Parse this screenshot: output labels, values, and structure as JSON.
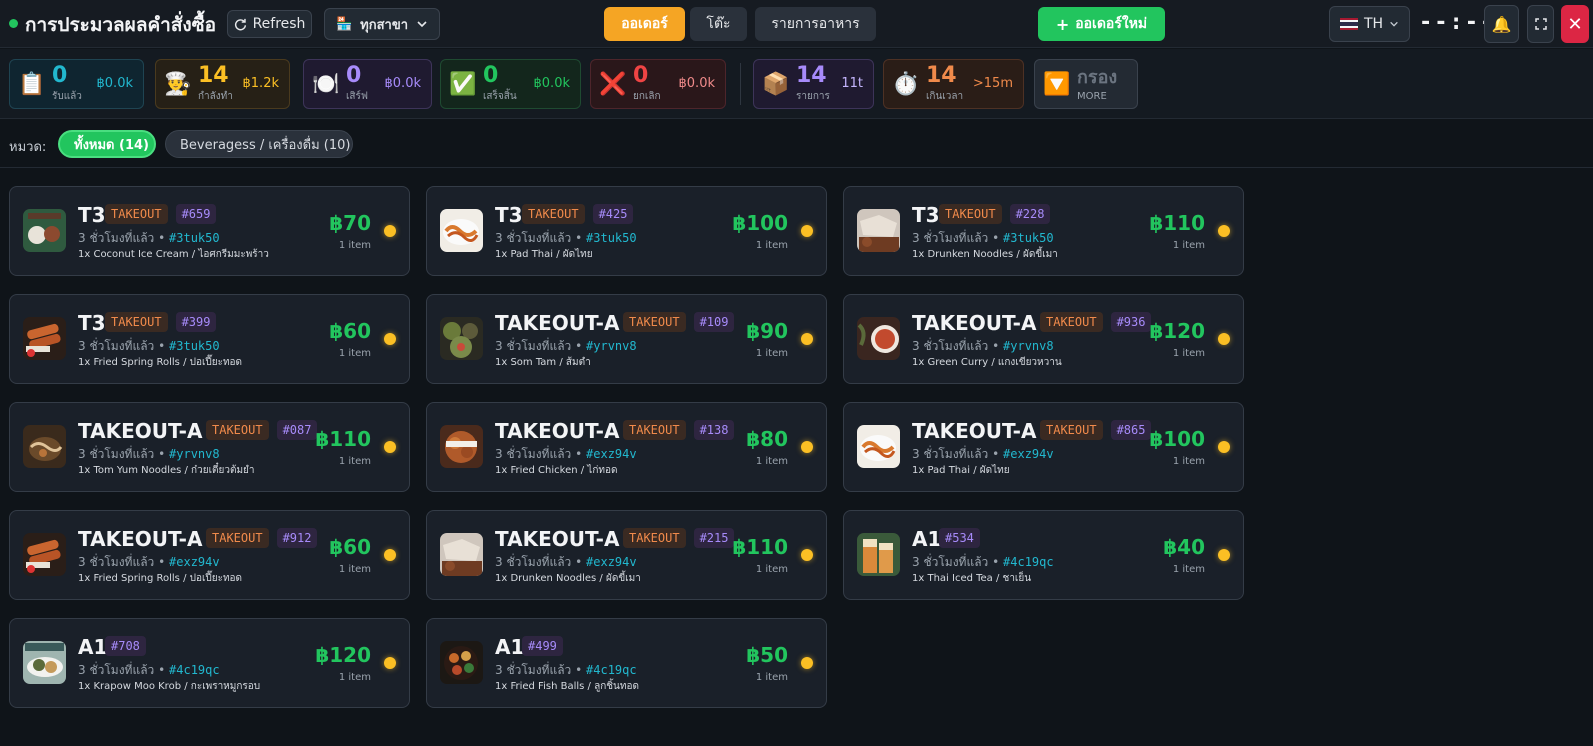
{
  "header": {
    "title": "การประมวลผลคำสั่งซื้อ",
    "refresh_label": "Refresh",
    "branch_label": "ทุกสาขา",
    "tabs": [
      "ออเดอร์",
      "โต๊ะ",
      "รายการอาหาร"
    ],
    "active_tab": "ออเดอร์",
    "new_order_label": "ออเดอร์ใหม่",
    "language": "TH",
    "clock": "--:--",
    "colors": {
      "accent": "#f5a524",
      "success": "#22c55e",
      "danger": "#dc2644"
    }
  },
  "stats": [
    {
      "icon": "📋",
      "count": "0",
      "label": "รับแล้ว",
      "value": "฿0.0k",
      "color": "#22b8cf"
    },
    {
      "icon": "👨‍🍳",
      "count": "14",
      "label": "กำลังทำ",
      "value": "฿1.2k",
      "color": "#fbbf24"
    },
    {
      "icon": "🍽️",
      "count": "0",
      "label": "เสิร์ฟ",
      "value": "฿0.0k",
      "color": "#a78bfa"
    },
    {
      "icon": "✅",
      "count": "0",
      "label": "เสร็จสิ้น",
      "value": "฿0.0k",
      "color": "#22c55e"
    },
    {
      "icon": "❌",
      "count": "0",
      "label": "ยกเลิก",
      "value": "฿0.0k",
      "color": "#ef4444"
    },
    {
      "icon": "📦",
      "count": "14",
      "label": "รายการ",
      "value": "11t",
      "color": "#a78bfa"
    },
    {
      "icon": "⏱️",
      "count": "14",
      "label": "เกินเวลา",
      "value": ">15m",
      "color": "#f08a4b"
    },
    {
      "icon": "🔽",
      "count": "กรอง",
      "label": "MORE",
      "value": "",
      "color": "#9aa3ad"
    }
  ],
  "categories": {
    "label": "หมวด:",
    "chips": [
      {
        "label": "ทั้งหมด  (14)",
        "active": true
      },
      {
        "label": "Beveragess / เครื่องดื่ม  (10)",
        "active": false
      }
    ]
  },
  "orders": [
    {
      "table": "T3",
      "type": "TAKEOUT",
      "number": "#659",
      "time": "3 ชั่วโมงที่แล้ว",
      "code": "#3tuk50",
      "items": "1x Coconut Ice Cream / ไอศกรีมมะพร้าว",
      "price": "฿70",
      "count": "1 item",
      "thumb": "dessert"
    },
    {
      "table": "T3",
      "type": "TAKEOUT",
      "number": "#425",
      "time": "3 ชั่วโมงที่แล้ว",
      "code": "#3tuk50",
      "items": "1x Pad Thai / ผัดไทย",
      "price": "฿100",
      "count": "1 item",
      "thumb": "noodle"
    },
    {
      "table": "T3",
      "type": "TAKEOUT",
      "number": "#228",
      "time": "3 ชั่วโมงที่แล้ว",
      "code": "#3tuk50",
      "items": "1x Drunken Noodles / ผัดขี้เมา",
      "price": "฿110",
      "count": "1 item",
      "thumb": "drunken"
    },
    {
      "table": "T3",
      "type": "TAKEOUT",
      "number": "#399",
      "time": "3 ชั่วโมงที่แล้ว",
      "code": "#3tuk50",
      "items": "1x Fried Spring Rolls / ปอเปี๊ยะทอด",
      "price": "฿60",
      "count": "1 item",
      "thumb": "roll"
    },
    {
      "table": "TAKEOUT-A",
      "type": "TAKEOUT",
      "number": "#109",
      "time": "3 ชั่วโมงที่แล้ว",
      "code": "#yrvnv8",
      "items": "1x Som Tam / ส้มตำ",
      "price": "฿90",
      "count": "1 item",
      "thumb": "salad"
    },
    {
      "table": "TAKEOUT-A",
      "type": "TAKEOUT",
      "number": "#936",
      "time": "3 ชั่วโมงที่แล้ว",
      "code": "#yrvnv8",
      "items": "1x Green Curry / แกงเขียวหวาน",
      "price": "฿120",
      "count": "1 item",
      "thumb": "curry"
    },
    {
      "table": "TAKEOUT-A",
      "type": "TAKEOUT",
      "number": "#087",
      "time": "3 ชั่วโมงที่แล้ว",
      "code": "#yrvnv8",
      "items": "1x Tom Yum Noodles / ก๋วยเตี๋ยวต้มยำ",
      "price": "฿110",
      "count": "1 item",
      "thumb": "tomyum"
    },
    {
      "table": "TAKEOUT-A",
      "type": "TAKEOUT",
      "number": "#138",
      "time": "3 ชั่วโมงที่แล้ว",
      "code": "#exz94v",
      "items": "1x Fried Chicken / ไก่ทอด",
      "price": "฿80",
      "count": "1 item",
      "thumb": "chicken"
    },
    {
      "table": "TAKEOUT-A",
      "type": "TAKEOUT",
      "number": "#865",
      "time": "3 ชั่วโมงที่แล้ว",
      "code": "#exz94v",
      "items": "1x Pad Thai / ผัดไทย",
      "price": "฿100",
      "count": "1 item",
      "thumb": "noodle"
    },
    {
      "table": "TAKEOUT-A",
      "type": "TAKEOUT",
      "number": "#912",
      "time": "3 ชั่วโมงที่แล้ว",
      "code": "#exz94v",
      "items": "1x Fried Spring Rolls / ปอเปี๊ยะทอด",
      "price": "฿60",
      "count": "1 item",
      "thumb": "roll"
    },
    {
      "table": "TAKEOUT-A",
      "type": "TAKEOUT",
      "number": "#215",
      "time": "3 ชั่วโมงที่แล้ว",
      "code": "#exz94v",
      "items": "1x Drunken Noodles / ผัดขี้เมา",
      "price": "฿110",
      "count": "1 item",
      "thumb": "drunken"
    },
    {
      "table": "A1",
      "type": "",
      "number": "#534",
      "time": "3 ชั่วโมงที่แล้ว",
      "code": "#4c19qc",
      "items": "1x Thai Iced Tea / ชาเย็น",
      "price": "฿40",
      "count": "1 item",
      "thumb": "tea"
    },
    {
      "table": "A1",
      "type": "",
      "number": "#708",
      "time": "3 ชั่วโมงที่แล้ว",
      "code": "#4c19qc",
      "items": "1x Krapow Moo Krob / กะเพราหมูกรอบ",
      "price": "฿120",
      "count": "1 item",
      "thumb": "krapow"
    },
    {
      "table": "A1",
      "type": "",
      "number": "#499",
      "time": "3 ชั่วโมงที่แล้ว",
      "code": "#4c19qc",
      "items": "1x Fried Fish Balls / ลูกชิ้นทอด",
      "price": "฿50",
      "count": "1 item",
      "thumb": "fishball"
    }
  ]
}
